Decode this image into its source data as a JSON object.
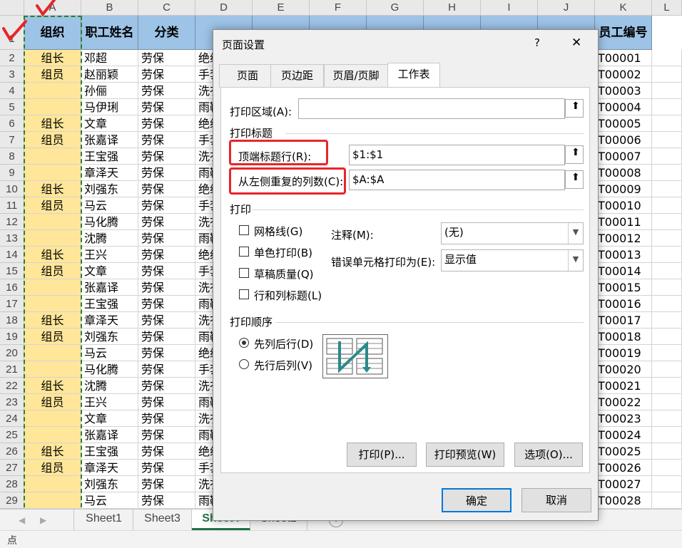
{
  "columns": [
    "A",
    "B",
    "C",
    "D",
    "E",
    "F",
    "G",
    "H",
    "I",
    "J",
    "K",
    "L"
  ],
  "header_row": [
    "组织",
    "职工姓名",
    "分类",
    "",
    "",
    "",
    "",
    "",
    "",
    "",
    "员工编号"
  ],
  "row_numbers": [
    "1",
    "2",
    "3",
    "4",
    "5",
    "6",
    "7",
    "8",
    "9",
    "10",
    "11",
    "12",
    "13",
    "14",
    "15",
    "16",
    "17",
    "18",
    "19",
    "20",
    "21",
    "22",
    "23",
    "24",
    "25",
    "26",
    "27",
    "28",
    "29"
  ],
  "rows": [
    [
      "组长",
      "邓超",
      "劳保",
      "绝缘",
      "T00001"
    ],
    [
      "组员",
      "赵丽颖",
      "劳保",
      "手套",
      "T00002"
    ],
    [
      "",
      "孙俪",
      "劳保",
      "洗衣",
      "T00003"
    ],
    [
      "",
      "马伊琍",
      "劳保",
      "雨靴",
      "T00004"
    ],
    [
      "组长",
      "文章",
      "劳保",
      "绝缘",
      "T00005"
    ],
    [
      "组员",
      "张嘉译",
      "劳保",
      "手套",
      "T00006"
    ],
    [
      "",
      "王宝强",
      "劳保",
      "洗衣",
      "T00007"
    ],
    [
      "",
      "章泽天",
      "劳保",
      "雨靴",
      "T00008"
    ],
    [
      "组长",
      "刘强东",
      "劳保",
      "绝缘",
      "T00009"
    ],
    [
      "组员",
      "马云",
      "劳保",
      "手套",
      "T00010"
    ],
    [
      "",
      "马化腾",
      "劳保",
      "洗衣",
      "T00011"
    ],
    [
      "",
      "沈腾",
      "劳保",
      "雨靴",
      "T00012"
    ],
    [
      "组长",
      "王兴",
      "劳保",
      "绝缘",
      "T00013"
    ],
    [
      "组员",
      "文章",
      "劳保",
      "手套",
      "T00014"
    ],
    [
      "",
      "张嘉译",
      "劳保",
      "洗衣",
      "T00015"
    ],
    [
      "",
      "王宝强",
      "劳保",
      "雨靴",
      "T00016"
    ],
    [
      "组长",
      "章泽天",
      "劳保",
      "洗衣",
      "T00017"
    ],
    [
      "组员",
      "刘强东",
      "劳保",
      "雨靴",
      "T00018"
    ],
    [
      "",
      "马云",
      "劳保",
      "绝缘",
      "T00019"
    ],
    [
      "",
      "马化腾",
      "劳保",
      "手套",
      "T00020"
    ],
    [
      "组长",
      "沈腾",
      "劳保",
      "洗衣",
      "T00021"
    ],
    [
      "组员",
      "王兴",
      "劳保",
      "雨靴",
      "T00022"
    ],
    [
      "",
      "文章",
      "劳保",
      "洗衣",
      "T00023"
    ],
    [
      "",
      "张嘉译",
      "劳保",
      "雨靴",
      "T00024"
    ],
    [
      "组长",
      "王宝强",
      "劳保",
      "绝缘",
      "T00025"
    ],
    [
      "组员",
      "章泽天",
      "劳保",
      "手套",
      "T00026"
    ],
    [
      "",
      "刘强东",
      "劳保",
      "洗衣",
      "T00027"
    ],
    [
      "",
      "马云",
      "劳保",
      "雨靴",
      "T00028"
    ]
  ],
  "sheet_tabs": [
    "Sheet1",
    "Sheet3",
    "Sheet4",
    "Sheet2"
  ],
  "active_sheet_index": 2,
  "status_text": "点",
  "dialog": {
    "title": "页面设置",
    "help": "?",
    "close": "✕",
    "tabs": [
      "页面",
      "页边距",
      "页眉/页脚",
      "工作表"
    ],
    "print_area_label": "打印区域(A):",
    "print_area_value": "",
    "print_titles_label": "打印标题",
    "top_rows_label": "顶端标题行(R):",
    "top_rows_value": "$1:$1",
    "left_cols_label": "从左侧重复的列数(C):",
    "left_cols_value": "$A:$A",
    "print_label": "打印",
    "gridlines_label": "网格线(G)",
    "mono_label": "单色打印(B)",
    "draft_label": "草稿质量(Q)",
    "rowcol_label": "行和列标题(L)",
    "comments_label": "注释(M):",
    "comments_value": "(无)",
    "errors_label": "错误单元格打印为(E):",
    "errors_value": "显示值",
    "order_label": "打印顺序",
    "down_then_over_label": "先列后行(D)",
    "over_then_down_label": "先行后列(V)",
    "print_btn": "打印(P)...",
    "preview_btn": "打印预览(W)",
    "options_btn": "选项(O)...",
    "ok_btn": "确定",
    "cancel_btn": "取消"
  },
  "colors": {
    "header_fill": "#9dc3e6",
    "group_fill": "#ffe699",
    "highlight_box": "#e8252a",
    "accent_button": "#0078d7"
  }
}
